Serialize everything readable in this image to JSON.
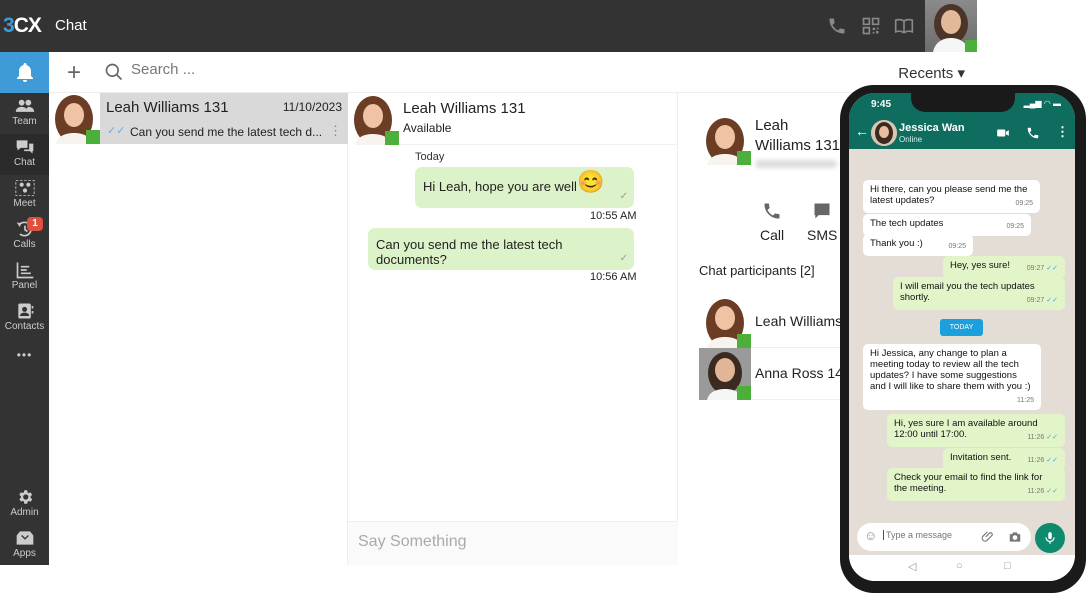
{
  "topbar": {
    "logo_digit": "3",
    "logo_letters": "CX",
    "app_title": "Chat",
    "icons": [
      "phone-icon",
      "qr-code-icon",
      "book-icon"
    ]
  },
  "sidebar": {
    "items": [
      {
        "label": "",
        "icon": "bell-icon",
        "active": true
      },
      {
        "label": "Team",
        "icon": "team-icon"
      },
      {
        "label": "Chat",
        "icon": "chat-icon"
      },
      {
        "label": "Meet",
        "icon": "meet-icon"
      },
      {
        "label": "Calls",
        "icon": "calls-icon",
        "badge": "1"
      },
      {
        "label": "Panel",
        "icon": "panel-icon"
      },
      {
        "label": "Contacts",
        "icon": "contacts-icon"
      },
      {
        "label": "•••",
        "icon": "more-icon"
      },
      {
        "label": "Admin",
        "icon": "gear-icon"
      },
      {
        "label": "Apps",
        "icon": "apps-icon"
      }
    ]
  },
  "toolbar": {
    "add_label": "+",
    "search_placeholder": "Search ...",
    "recents_label": "Recents ▾"
  },
  "chat_list": [
    {
      "name": "Leah Williams 131",
      "date": "11/10/2023",
      "snippet": "Can you send me the latest tech d...",
      "status": "available"
    }
  ],
  "conversation": {
    "name": "Leah Williams 131",
    "status": "Available",
    "day_label": "Today",
    "messages": [
      {
        "text": "Hi Leah, hope you are well",
        "emoji": "😊",
        "time": "10:55 AM"
      },
      {
        "text": "Can you send me the latest tech documents?",
        "time": "10:56 AM"
      }
    ],
    "compose_placeholder": "Say Something"
  },
  "info_panel": {
    "name": "Leah Williams 131",
    "actions": [
      {
        "label": "Call",
        "icon": "phone-icon"
      },
      {
        "label": "SMS",
        "icon": "sms-icon"
      }
    ],
    "participants_label": "Chat participants [2]",
    "participants": [
      {
        "name": "Leah Williams 131"
      },
      {
        "name": "Anna Ross 14"
      }
    ]
  },
  "phone": {
    "time": "9:45",
    "contact_name": "Jessica Wan",
    "contact_status": "Online",
    "today_label": "TODAY",
    "input_placeholder": "Type a message",
    "messages": [
      {
        "dir": "in",
        "text": "Hi there, can you please send me the latest updates?",
        "time": "09:25"
      },
      {
        "dir": "in",
        "text": "The tech updates",
        "time": "09:25"
      },
      {
        "dir": "in",
        "text": "Thank you :)",
        "time": "09:25"
      },
      {
        "dir": "out",
        "text": "Hey, yes sure!",
        "time": "09:27"
      },
      {
        "dir": "out",
        "text": "I will email you the tech updates shortly.",
        "time": "09:27"
      },
      {
        "dir": "in",
        "text": "Hi Jessica, any change to plan a meeting today to review all the tech updates? I have some suggestions and I will like to share them with you :)",
        "time": "11:25"
      },
      {
        "dir": "out",
        "text": "Hi, yes sure I am available around 12:00 until 17:00.",
        "time": "11:26"
      },
      {
        "dir": "out",
        "text": "Invitation sent.",
        "time": "11:26"
      },
      {
        "dir": "out",
        "text": "Check your email to find the link for the meeting.",
        "time": "11:26"
      }
    ],
    "read_tick": "✓✓",
    "nav": [
      "◁",
      "○",
      "□"
    ]
  },
  "colors": {
    "accent": "#3f9bd8",
    "topbar": "#333333",
    "available": "#4caf3a",
    "bubble": "#dcf2c8",
    "whatsapp_green": "#0e6d5e"
  }
}
